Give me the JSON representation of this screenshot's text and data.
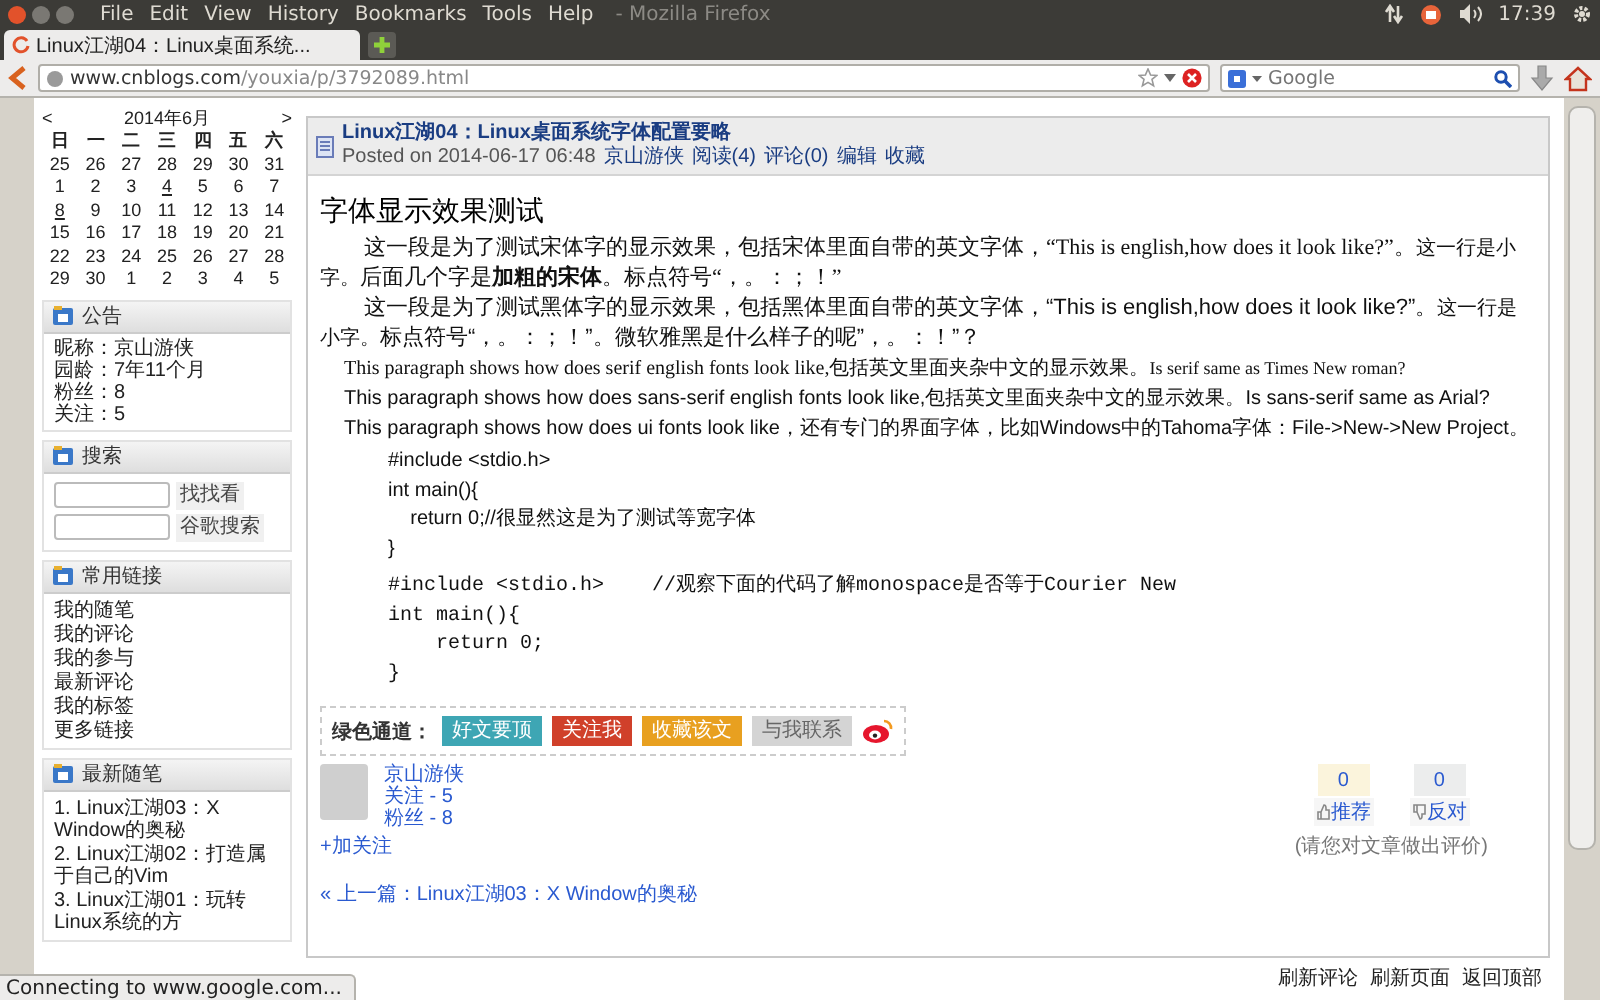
{
  "window": {
    "title": "- Mozilla Firefox",
    "menu": [
      "File",
      "Edit",
      "View",
      "History",
      "Bookmarks",
      "Tools",
      "Help"
    ]
  },
  "system_tray": {
    "clock": "17:39"
  },
  "tabs": [
    {
      "label": "Linux江湖04：Linux桌面系统...",
      "selected": true
    }
  ],
  "address_bar": {
    "domain": "www.cnblogs.com",
    "path": "/youxia/p/3792089.html"
  },
  "search_box": {
    "placeholder": "Google"
  },
  "calendar": {
    "prev": "<",
    "title": "2014年6月",
    "next": ">",
    "weekdays": [
      "日",
      "一",
      "二",
      "三",
      "四",
      "五",
      "六"
    ],
    "weeks": [
      [
        {
          "day": "25",
          "linked": false
        },
        {
          "day": "26",
          "linked": false
        },
        {
          "day": "27",
          "linked": false
        },
        {
          "day": "28",
          "linked": false
        },
        {
          "day": "29",
          "linked": false
        },
        {
          "day": "30",
          "linked": false
        },
        {
          "day": "31",
          "linked": false
        }
      ],
      [
        {
          "day": "1",
          "linked": false
        },
        {
          "day": "2",
          "linked": false
        },
        {
          "day": "3",
          "linked": false
        },
        {
          "day": "4",
          "linked": true
        },
        {
          "day": "5",
          "linked": false
        },
        {
          "day": "6",
          "linked": false
        },
        {
          "day": "7",
          "linked": false
        }
      ],
      [
        {
          "day": "8",
          "linked": true
        },
        {
          "day": "9",
          "linked": false
        },
        {
          "day": "10",
          "linked": false
        },
        {
          "day": "11",
          "linked": false
        },
        {
          "day": "12",
          "linked": false
        },
        {
          "day": "13",
          "linked": false
        },
        {
          "day": "14",
          "linked": false
        }
      ],
      [
        {
          "day": "15",
          "linked": false
        },
        {
          "day": "16",
          "linked": false
        },
        {
          "day": "17",
          "linked": false
        },
        {
          "day": "18",
          "linked": false
        },
        {
          "day": "19",
          "linked": false
        },
        {
          "day": "20",
          "linked": false
        },
        {
          "day": "21",
          "linked": false
        }
      ],
      [
        {
          "day": "22",
          "linked": false
        },
        {
          "day": "23",
          "linked": false
        },
        {
          "day": "24",
          "linked": false
        },
        {
          "day": "25",
          "linked": false
        },
        {
          "day": "26",
          "linked": false
        },
        {
          "day": "27",
          "linked": false
        },
        {
          "day": "28",
          "linked": false
        }
      ],
      [
        {
          "day": "29",
          "linked": false
        },
        {
          "day": "30",
          "linked": false
        },
        {
          "day": "1",
          "linked": false
        },
        {
          "day": "2",
          "linked": false
        },
        {
          "day": "3",
          "linked": false
        },
        {
          "day": "4",
          "linked": false
        },
        {
          "day": "5",
          "linked": false
        }
      ]
    ]
  },
  "sidebar": {
    "panels": [
      {
        "kind": "lines",
        "title": "公告",
        "items": [
          "昵称：京山游侠",
          "园龄：7年11个月",
          "粉丝：8",
          "关注：5"
        ]
      },
      {
        "kind": "search",
        "title": "搜索",
        "items": [
          "找找看",
          "谷歌搜索"
        ]
      },
      {
        "kind": "links",
        "title": "常用链接",
        "items": [
          "我的随笔",
          "我的评论",
          "我的参与",
          "最新评论",
          "我的标签",
          "更多链接"
        ]
      },
      {
        "kind": "links",
        "title": "最新随笔",
        "items": [
          "1. Linux江湖03：X Window的奥秘",
          "2. Linux江湖02：打造属于自己的Vim",
          "3. Linux江湖01：玩转Linux系统的方"
        ]
      }
    ]
  },
  "post": {
    "title": "Linux江湖04：Linux桌面系统字体配置要略",
    "posted": "Posted on 2014-06-17 06:48",
    "author": "京山游侠",
    "meta": [
      "阅读(4)",
      "评论(0)",
      "编辑",
      "收藏"
    ],
    "heading": "字体显示效果测试",
    "paragraphs": [
      {
        "kind": "song",
        "segments": [
          {
            "kind": "normal",
            "text": "这一段是为了测试宋体字的显示效果，包括宋体里面自带的英文字体，“This is english,how does it look like?”。"
          },
          {
            "kind": "small",
            "text": "这一行是小字。"
          },
          {
            "kind": "normal",
            "text": "后面几个字是"
          },
          {
            "kind": "bold",
            "text": "加粗的宋体"
          },
          {
            "kind": "normal",
            "text": "。标点符号“，。：；！”"
          }
        ]
      },
      {
        "kind": "hei",
        "segments": [
          {
            "kind": "normal",
            "text": "这一段是为了测试黑体字的显示效果，包括黑体里面自带的英文字体，“This is english,how does it look like?”。"
          },
          {
            "kind": "small",
            "text": "这一行是小字。"
          },
          {
            "kind": "normal",
            "text": "标点符号“，。：；！”。微软雅黑是什么样子的呢”，。：！”？"
          }
        ]
      },
      {
        "kind": "serif",
        "segments": [
          {
            "kind": "normal",
            "text": "This paragraph shows how does serif english fonts look like,包括英文里面夹杂中文的显示效果。"
          },
          {
            "kind": "times",
            "text": "Is serif same as Times New roman?"
          }
        ]
      },
      {
        "kind": "sans",
        "segments": [
          {
            "kind": "normal",
            "text": "This paragraph shows how does sans-serif english fonts look like,包括英文里面夹杂中文的显示效果。Is sans-serif same as Arial?"
          }
        ]
      },
      {
        "kind": "ui",
        "segments": [
          {
            "kind": "normal",
            "text": "This paragraph shows how does ui fonts look like，还有专门的界面字体，比如Windows中的Tahoma字体：File->New->New Project。"
          }
        ]
      }
    ],
    "code_blocks": [
      {
        "kind": "sans",
        "lines": [
          "#include <stdio.h>",
          "int main(){",
          "    return 0;//很显然这是为了测试等宽字体",
          "}"
        ]
      },
      {
        "kind": "mono",
        "lines": [
          "#include <stdio.h>    //观察下面的代码了解monospace是否等于Courier New",
          "int main(){",
          "    return 0;",
          "}"
        ]
      }
    ]
  },
  "share": {
    "label": "绿色通道：",
    "buttons": [
      {
        "label": "好文要顶",
        "color": "#3ea6b4"
      },
      {
        "label": "关注我",
        "color": "#d0402a"
      },
      {
        "label": "收藏该文",
        "color": "#e8a020"
      },
      {
        "label": "与我联系",
        "color": "#d4d4d4"
      }
    ]
  },
  "author_box": {
    "name": "京山游侠",
    "following": "关注 - 5",
    "followers": "粉丝 - 8",
    "follow": "+加关注"
  },
  "votes": [
    {
      "kind": "up",
      "count": "0",
      "label": "推荐"
    },
    {
      "kind": "down",
      "count": "0",
      "label": "反对"
    }
  ],
  "vote_hint": "(请您对文章做出评价)",
  "prev_post": {
    "prefix": "« 上一篇：",
    "title": "Linux江湖03：X Window的奥秘"
  },
  "footer_links": [
    "刷新评论",
    "刷新页面",
    "返回顶部"
  ],
  "status_bar": "Connecting to www.google.com..."
}
